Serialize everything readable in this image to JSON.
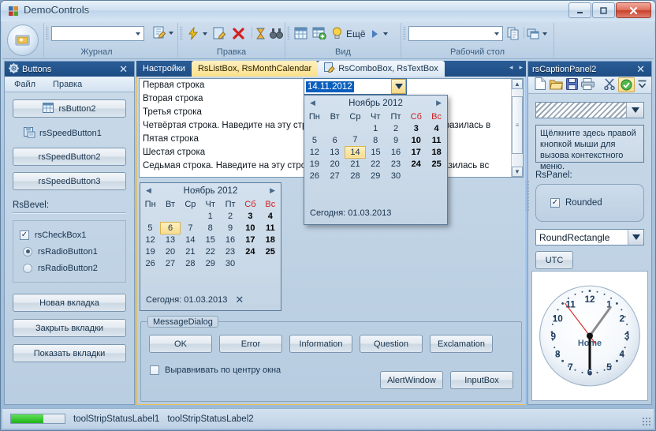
{
  "window": {
    "title": "DemoControls",
    "icon": "app-icon",
    "minimize": "–",
    "maximize": "□",
    "close": "✕"
  },
  "ribbon": {
    "orb_icon": "office-orb-icon",
    "groups": [
      {
        "label": "Журнал",
        "combo_value": "",
        "icons": [
          "edit-note-icon"
        ]
      },
      {
        "label": "Правка",
        "icons": [
          "lightning-icon",
          "edit-page-icon",
          "delete-x-icon",
          "hourglass-icon",
          "binoculars-icon"
        ]
      },
      {
        "label": "Вид",
        "icons": [
          "table-icon",
          "table-add-icon",
          "lightbulb-icon"
        ],
        "more_label": "Ещё"
      },
      {
        "label": "Рабочий стол",
        "combo_value": "",
        "icons": [
          "copy-icon",
          "windows-arrange-icon"
        ]
      }
    ]
  },
  "left_panel": {
    "caption": "Buttons",
    "caption_icon": "gear-icon",
    "close_icon": "✕",
    "menu": [
      "Файл",
      "Правка"
    ],
    "button1": "rsButton2",
    "button1_icon": "grid-icon",
    "speed1": "rsSpeedButton1",
    "speed1_icon": "save-as-icon",
    "speed2": "rsSpeedButton2",
    "speed3": "rsSpeedButton3",
    "bevel_label": "RsBevel:",
    "checkbox1": "rsCheckBox1",
    "checkbox1_checked": "✓",
    "radio1": "rsRadioButton1",
    "radio2": "rsRadioButton2",
    "action1": "Новая вкладка",
    "action2": "Закрыть вкладки",
    "action3": "Показать вкладки"
  },
  "tabs": [
    {
      "label": "Настройки",
      "state": "inactive"
    },
    {
      "label": "RsListBox, RsMonthCalendar",
      "state": "active"
    },
    {
      "label": "RsComboBox, RsTextBox",
      "state": "selected",
      "icon": "edit-page-icon"
    }
  ],
  "tab_nav": {
    "prev": "◂",
    "next": "▸"
  },
  "listbox": {
    "items": [
      "Первая строка",
      "Вторая строка",
      "Третья строка",
      "Четвёртая строка. Наведите на эту строку указатель мыши, чтобы отобразилась в",
      "Пятая строка",
      "Шестая строка",
      "Седьмая строка. Наведите на эту строку указатель мыши, чтобы отобразилась вс"
    ],
    "scroll_up": "▲",
    "scroll_down": "▼",
    "thumb_glyph": "≡"
  },
  "calendar1": {
    "month_title": "Ноябрь 2012",
    "prev": "◀",
    "next": "▶",
    "weekdays": [
      "Пн",
      "Вт",
      "Ср",
      "Чт",
      "Пт",
      "Сб",
      "Вс"
    ],
    "weekend_index": [
      5,
      6
    ],
    "weeks": [
      [
        "",
        "",
        "",
        "1",
        "2",
        "3",
        "4"
      ],
      [
        "5",
        "6",
        "7",
        "8",
        "9",
        "10",
        "11"
      ],
      [
        "12",
        "13",
        "14",
        "15",
        "16",
        "17",
        "18"
      ],
      [
        "19",
        "20",
        "21",
        "22",
        "23",
        "24",
        "25"
      ],
      [
        "26",
        "27",
        "28",
        "29",
        "30",
        "",
        ""
      ]
    ],
    "selected": "6",
    "today_label": "Сегодня: 01.03.2013",
    "clear_icon": "✕"
  },
  "date_combo": {
    "value": "14.11.2012",
    "dropdown_icon": "▼"
  },
  "calendar2": {
    "month_title": "Ноябрь 2012",
    "prev": "◀",
    "next": "▶",
    "weekdays": [
      "Пн",
      "Вт",
      "Ср",
      "Чт",
      "Пт",
      "Сб",
      "Вс"
    ],
    "weekend_index": [
      5,
      6
    ],
    "weeks": [
      [
        "",
        "",
        "",
        "1",
        "2",
        "3",
        "4"
      ],
      [
        "5",
        "6",
        "7",
        "8",
        "9",
        "10",
        "11"
      ],
      [
        "12",
        "13",
        "14",
        "15",
        "16",
        "17",
        "18"
      ],
      [
        "19",
        "20",
        "21",
        "22",
        "23",
        "24",
        "25"
      ],
      [
        "26",
        "27",
        "28",
        "29",
        "30",
        "",
        ""
      ]
    ],
    "selected": "14",
    "today_label": "Сегодня: 01.03.2013"
  },
  "message_dialog": {
    "group_label": "MessageDialog",
    "buttons_row1": [
      "OK",
      "Error",
      "Information",
      "Question",
      "Exclamation"
    ],
    "checkbox_label": "Выравнивать по центру окна",
    "checkbox_checked": false,
    "buttons_row2": [
      "AlertWindow",
      "InputBox"
    ]
  },
  "right_panel": {
    "caption": "rsCaptionPanel2",
    "close_icon": "✕",
    "toolbar_icons": [
      "new-document-icon",
      "open-folder-icon",
      "save-icon",
      "print-icon",
      "cut-scissors-icon",
      "check-circle-icon",
      "overflow-icon"
    ],
    "hatch_combo_value": "",
    "hatch_combo_arrow": "▼",
    "memo_text": "Щёлкните здесь правой кнопкой мыши для вызова контекстного меню.",
    "panel_label": "RsPanel:",
    "rounded_checkbox": "Rounded",
    "rounded_checked": "✓",
    "shape_combo_value": "RoundRectangle",
    "shape_combo_arrow": "▼",
    "utc_button": "UTC"
  },
  "clock": {
    "face_label": "Home",
    "hour_numbers": [
      "12",
      "1",
      "2",
      "3",
      "4",
      "5",
      "6",
      "7",
      "8",
      "9",
      "10",
      "11"
    ],
    "hour_hand_deg": 180,
    "minute_hand_deg": 35,
    "second_hand_deg": 322,
    "second_color": "#e02020",
    "minute_color": "#8a8a8a",
    "hour_color": "#111111"
  },
  "statusbar": {
    "progress_percent": 60,
    "label1": "toolStripStatusLabel1",
    "label2": "toolStripStatusLabel2"
  }
}
